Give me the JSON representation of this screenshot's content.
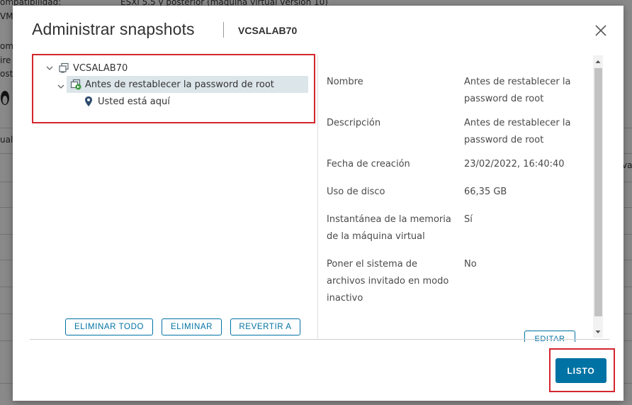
{
  "background": {
    "texts": [
      "ompatibilidad:",
      "ESXi 5.5 y posterior (máquina virtual versión 10)",
      "VMw",
      "om",
      "ire",
      "ost",
      "ual",
      "va"
    ]
  },
  "modal": {
    "title": "Administrar snapshots",
    "subtitle": "VCSALAB70"
  },
  "tree": {
    "root_label": "VCSALAB70",
    "snapshot_label": "Antes de restablecer la password de root",
    "current_label": "Usted está aquí"
  },
  "actions": {
    "delete_all": "ELIMINAR TODO",
    "delete": "ELIMINAR",
    "revert": "REVERTIR A",
    "edit": "EDITAR",
    "done": "LISTO"
  },
  "details": [
    {
      "label": "Nombre",
      "value": "Antes de restablecer la password de root"
    },
    {
      "label": "Descripción",
      "value": "Antes de restablecer la password de root"
    },
    {
      "label": "Fecha de creación",
      "value": "23/02/2022, 16:40:40"
    },
    {
      "label": "Uso de disco",
      "value": "66,35 GB"
    },
    {
      "label": "Instantánea de la memoria de la máquina virtual",
      "value": "Sí"
    },
    {
      "label": "Poner el sistema de archivos invitado en modo inactivo",
      "value": "No"
    }
  ],
  "colors": {
    "accent": "#0072a3",
    "highlight_box": "#d3262e",
    "selected_row": "#dce5ea"
  }
}
